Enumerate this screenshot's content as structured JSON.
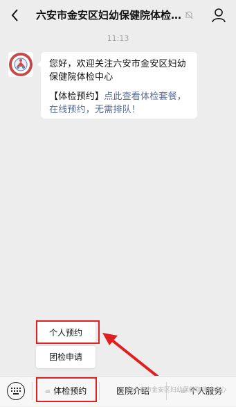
{
  "header": {
    "title": "六安市金安区妇幼保健院体检…"
  },
  "chat": {
    "timestamp": "11:13",
    "greeting": "您好，欢迎关注六安市金安区妇幼保健院体检中心",
    "promo_bracket": "【体检预约】",
    "promo_link": "点此查看体检套餐，在线预约，无需排队！"
  },
  "popup_menu": {
    "items": [
      "个人预约",
      "团检申请"
    ]
  },
  "bottom_menu": {
    "items": [
      {
        "label": "体检预约"
      },
      {
        "label": "医院介绍"
      },
      {
        "label": "个人服务"
      }
    ]
  },
  "watermark": "六安市金安区妇幼保健院体检中心",
  "colors": {
    "link": "#576b95",
    "highlight_box": "#e02020",
    "background": "#ededed"
  }
}
